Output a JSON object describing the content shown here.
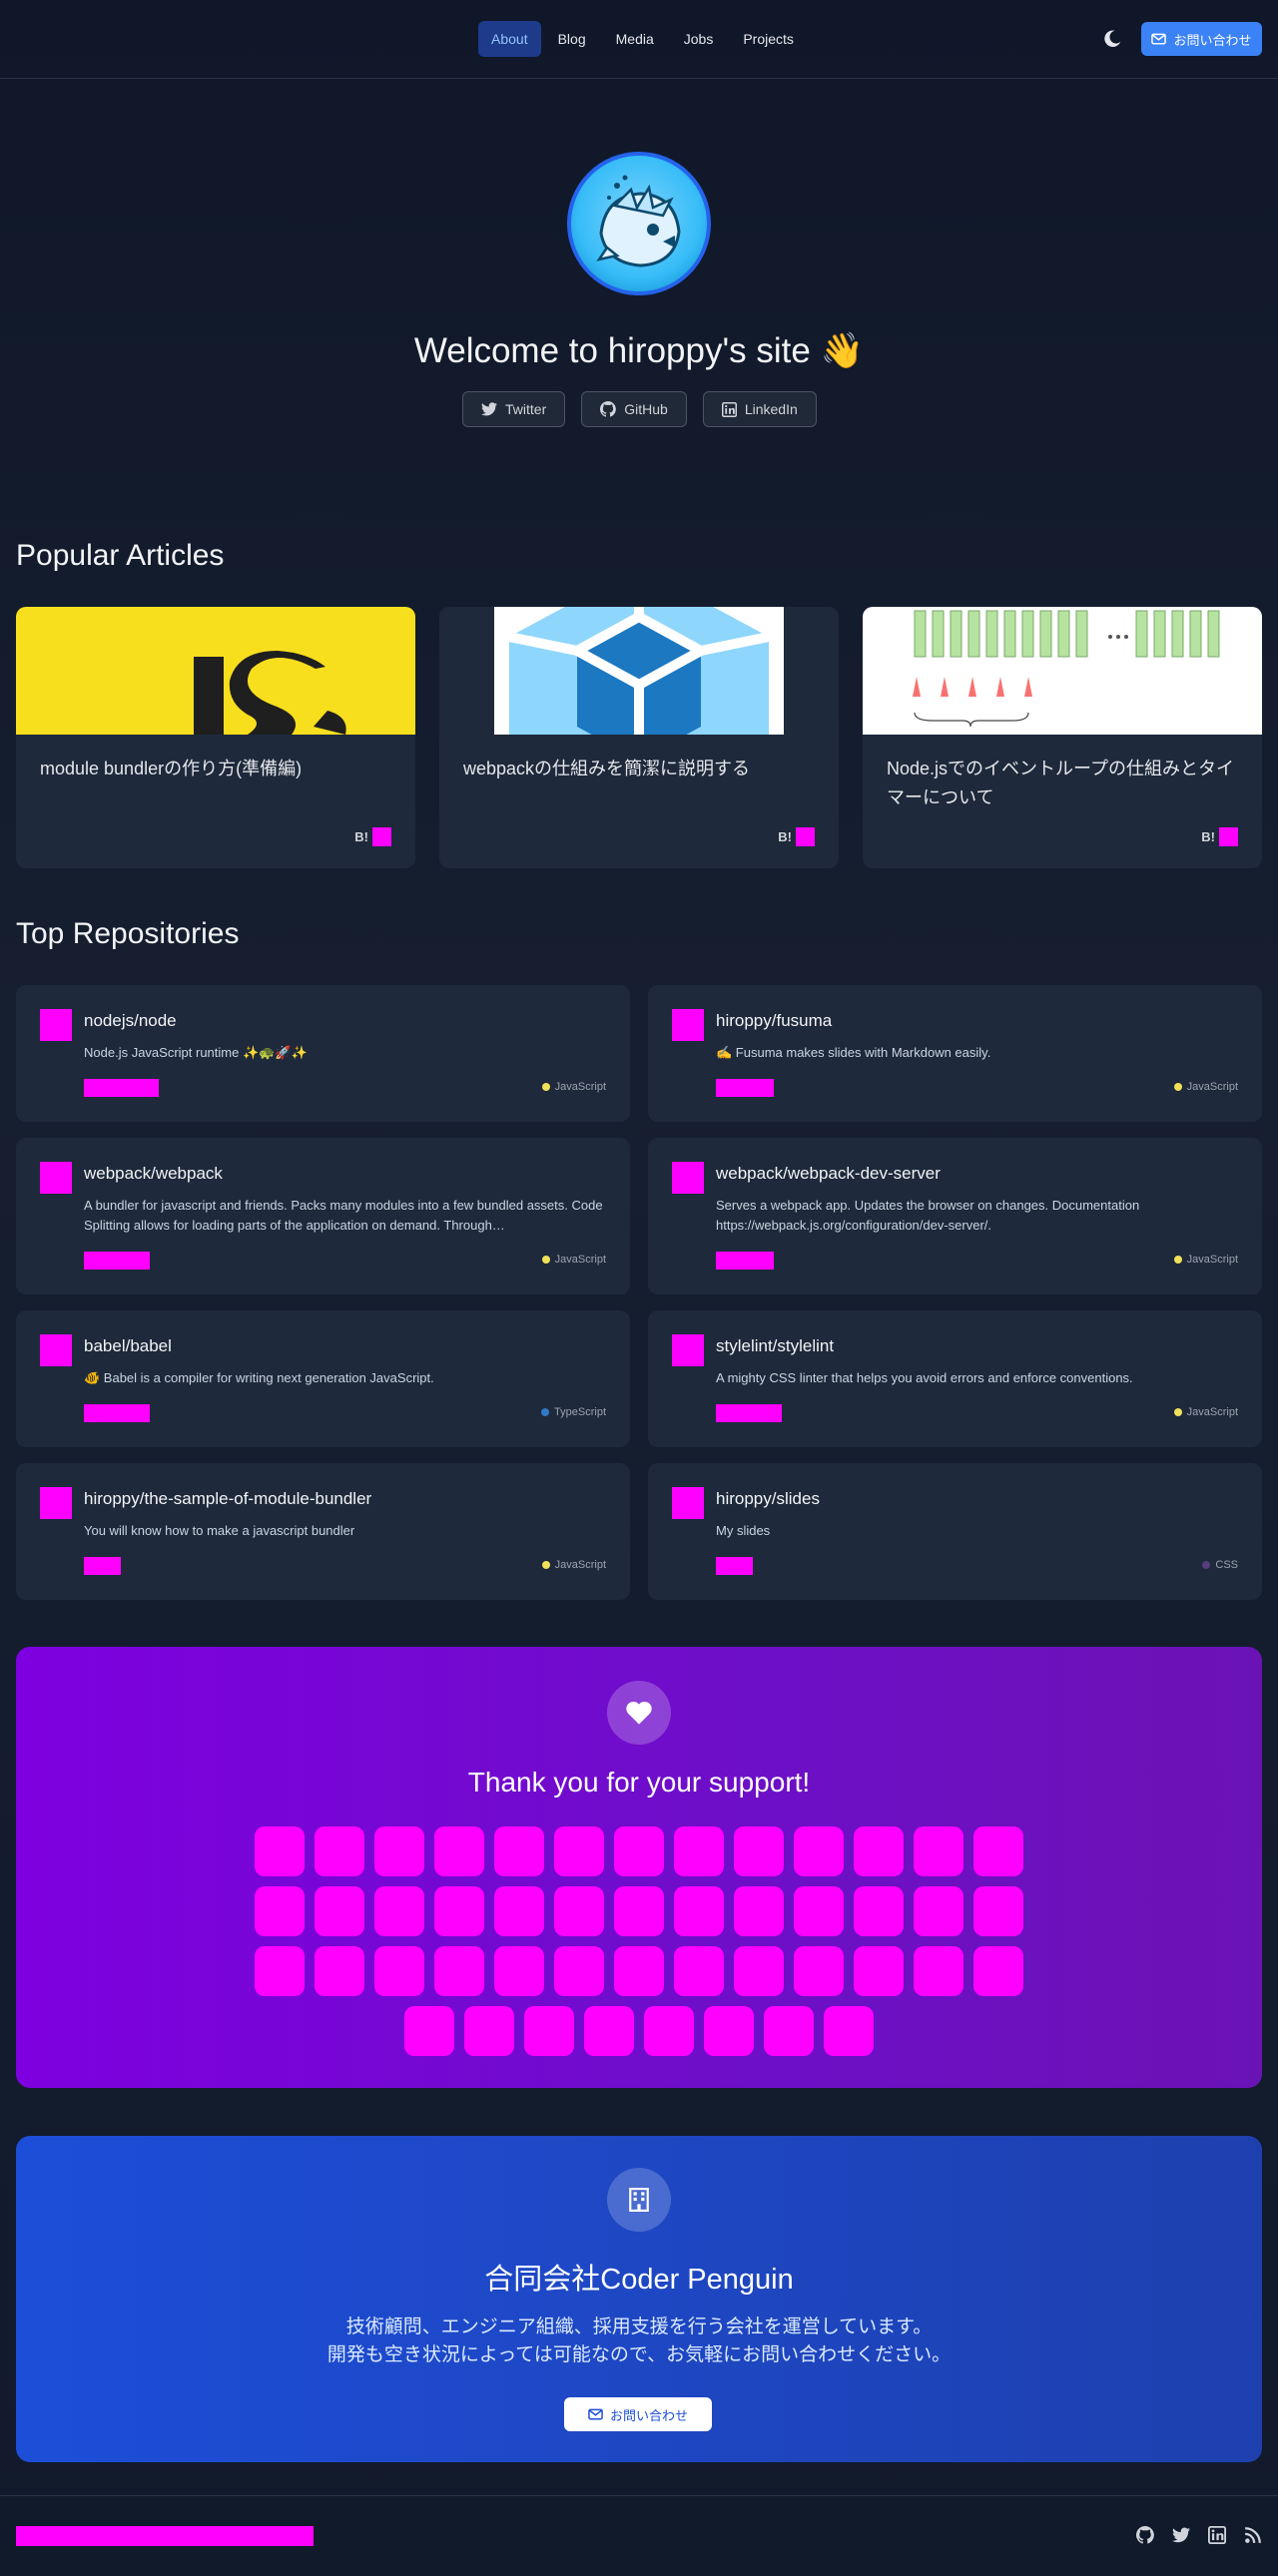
{
  "nav": {
    "items": [
      {
        "label": "About",
        "active": true
      },
      {
        "label": "Blog",
        "active": false
      },
      {
        "label": "Media",
        "active": false
      },
      {
        "label": "Jobs",
        "active": false
      },
      {
        "label": "Projects",
        "active": false
      }
    ],
    "theme_icon": "moon-icon",
    "contact_label": "お問い合わせ"
  },
  "hero": {
    "title": "Welcome to hiroppy's site 👋",
    "social": [
      {
        "label": "Twitter",
        "icon": "twitter-icon"
      },
      {
        "label": "GitHub",
        "icon": "github-icon"
      },
      {
        "label": "LinkedIn",
        "icon": "linkedin-icon"
      }
    ]
  },
  "articles": {
    "heading": "Popular Articles",
    "items": [
      {
        "title": "module bundlerの作り方(準備編)",
        "badge": "B!"
      },
      {
        "title": "webpackの仕組みを簡潔に説明する",
        "badge": "B!"
      },
      {
        "title": "Node.jsでのイベントループの仕組みとタイマーについて",
        "badge": "B!"
      }
    ]
  },
  "repos": {
    "heading": "Top Repositories",
    "items": [
      {
        "name": "nodejs/node",
        "desc": "Node.js JavaScript runtime ✨🐢🚀✨",
        "lang": "JavaScript",
        "lang_color": "#f1e05a"
      },
      {
        "name": "hiroppy/fusuma",
        "desc": "✍️ Fusuma makes slides with Markdown easily.",
        "lang": "JavaScript",
        "lang_color": "#f1e05a"
      },
      {
        "name": "webpack/webpack",
        "desc": "A bundler for javascript and friends. Packs many modules into a few bundled assets. Code Splitting allows for loading parts of the application on demand. Through…",
        "lang": "JavaScript",
        "lang_color": "#f1e05a"
      },
      {
        "name": "webpack/webpack-dev-server",
        "desc": "Serves a webpack app. Updates the browser on changes. Documentation https://webpack.js.org/configuration/dev-server/.",
        "lang": "JavaScript",
        "lang_color": "#f1e05a"
      },
      {
        "name": "babel/babel",
        "desc": "🐠 Babel is a compiler for writing next generation JavaScript.",
        "lang": "TypeScript",
        "lang_color": "#3178c6"
      },
      {
        "name": "stylelint/stylelint",
        "desc": "A mighty CSS linter that helps you avoid errors and enforce conventions.",
        "lang": "JavaScript",
        "lang_color": "#f1e05a"
      },
      {
        "name": "hiroppy/the-sample-of-module-bundler",
        "desc": "You will know how to make a javascript bundler",
        "lang": "JavaScript",
        "lang_color": "#f1e05a"
      },
      {
        "name": "hiroppy/slides",
        "desc": "My slides",
        "lang": "CSS",
        "lang_color": "#563d7c"
      }
    ]
  },
  "sponsors": {
    "title": "Thank you for your support!",
    "icon": "heart-icon"
  },
  "company": {
    "name": "合同会社Coder Penguin",
    "desc_line1": "技術顧問、エンジニア組織、採用支援を行う会社を運営しています。",
    "desc_line2": "開発も空き状況によっては可能なので、お気軽にお問い合わせください。",
    "contact_label": "お問い合わせ",
    "icon": "building-icon"
  },
  "footer": {
    "icons": [
      "github-icon",
      "twitter-icon",
      "linkedin-icon",
      "rss-icon"
    ]
  }
}
